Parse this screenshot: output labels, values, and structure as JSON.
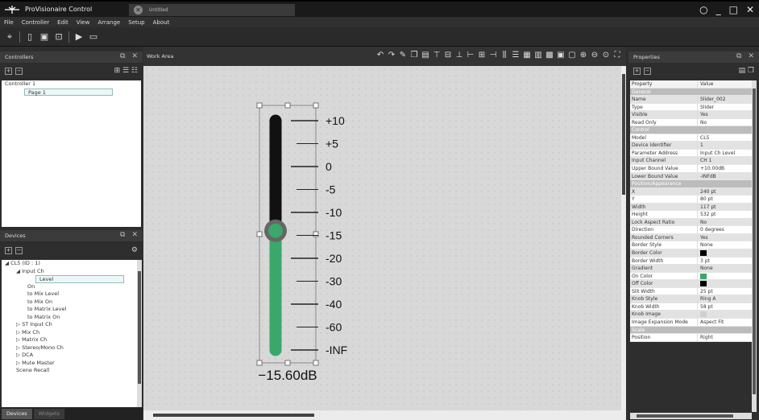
{
  "app": {
    "title": "ProVisionaire Control",
    "doc_tab": "Untitled",
    "window_controls": [
      "○",
      "_",
      "□",
      "✕"
    ]
  },
  "menu": [
    "File",
    "Controller",
    "Edit",
    "View",
    "Arrange",
    "Setup",
    "About"
  ],
  "controllers_panel": {
    "title": "Controllers",
    "items": [
      {
        "label": "Controller 1",
        "indent": 0,
        "expanded": true
      },
      {
        "label": "Page 1",
        "indent": 1,
        "selected": true
      }
    ]
  },
  "devices_panel": {
    "title": "Devices",
    "items": [
      {
        "label": "CL5 (ID : 1)",
        "indent": 0,
        "arrow": "◢"
      },
      {
        "label": "Input Ch",
        "indent": 1,
        "arrow": "◢"
      },
      {
        "label": "Level",
        "indent": 2,
        "selected": true
      },
      {
        "label": "On",
        "indent": 2
      },
      {
        "label": "to Mix Level",
        "indent": 2
      },
      {
        "label": "to Mix On",
        "indent": 2
      },
      {
        "label": "to Matrix Level",
        "indent": 2
      },
      {
        "label": "to Matrix On",
        "indent": 2
      },
      {
        "label": "ST Input Ch",
        "indent": 1,
        "arrow": "▷"
      },
      {
        "label": "Mix Ch",
        "indent": 1,
        "arrow": "▷"
      },
      {
        "label": "Matrix Ch",
        "indent": 1,
        "arrow": "▷"
      },
      {
        "label": "Stereo/Mono Ch",
        "indent": 1,
        "arrow": "▷"
      },
      {
        "label": "DCA",
        "indent": 1,
        "arrow": "▷"
      },
      {
        "label": "Mute Master",
        "indent": 1,
        "arrow": "▷"
      },
      {
        "label": "Scene Recall",
        "indent": 1
      }
    ]
  },
  "bottom_tabs": [
    "Devices",
    "Widgets"
  ],
  "work_area": {
    "title": "Work Area"
  },
  "slider": {
    "scale": [
      "+10",
      "+5",
      "0",
      "-5",
      "-10",
      "-15",
      "-20",
      "-30",
      "-40",
      "-60",
      "-INF"
    ],
    "value_label": "−15.60dB",
    "value_fraction": 0.52,
    "on_color": "#3aa86b",
    "off_color": "#111111"
  },
  "properties": {
    "title": "Properties",
    "header": [
      "Property",
      "Value"
    ],
    "rows": [
      {
        "section": "General"
      },
      {
        "k": "Name",
        "v": "Slider_002"
      },
      {
        "k": "Type",
        "v": "Slider"
      },
      {
        "k": "Visible",
        "v": "Yes"
      },
      {
        "k": "Read Only",
        "v": "No"
      },
      {
        "section": "Control"
      },
      {
        "k": "Model",
        "v": "CL5"
      },
      {
        "k": "Device Identifier",
        "v": "1"
      },
      {
        "k": "Parameter Address",
        "v": "Input Ch Level"
      },
      {
        "k": "Input Channel",
        "v": "CH 1"
      },
      {
        "k": "Upper Bound Value",
        "v": "+10.00dB"
      },
      {
        "k": "Lower Bound Value",
        "v": "-INFdB"
      },
      {
        "section": "Position/Appearance"
      },
      {
        "k": "X",
        "v": "240 pt"
      },
      {
        "k": "Y",
        "v": "80 pt"
      },
      {
        "k": "Width",
        "v": "117 pt"
      },
      {
        "k": "Height",
        "v": "532 pt"
      },
      {
        "k": "Lock Aspect Ratio",
        "v": "No"
      },
      {
        "k": "Direction",
        "v": "0 degrees"
      },
      {
        "k": "Rounded Corners",
        "v": "Yes"
      },
      {
        "k": "Border Style",
        "v": "None"
      },
      {
        "k": "Border Color",
        "v": "",
        "swatch": "#000000"
      },
      {
        "k": "Border Width",
        "v": "3 pt"
      },
      {
        "k": "Gradient",
        "v": "None"
      },
      {
        "k": "On Color",
        "v": "",
        "swatch": "#3aa86b"
      },
      {
        "k": "Off Color",
        "v": "",
        "swatch": "#000000"
      },
      {
        "k": "Slit Width",
        "v": "25 pt"
      },
      {
        "k": "Knob Style",
        "v": "Ring A"
      },
      {
        "k": "Knob Width",
        "v": "58 pt"
      },
      {
        "k": "Knob Image",
        "v": "",
        "swatch": "#d0d0d0"
      },
      {
        "k": "Image Expansion Mode",
        "v": "Aspect Fit"
      },
      {
        "section": "Scale"
      },
      {
        "k": "Position",
        "v": "Right"
      }
    ]
  }
}
